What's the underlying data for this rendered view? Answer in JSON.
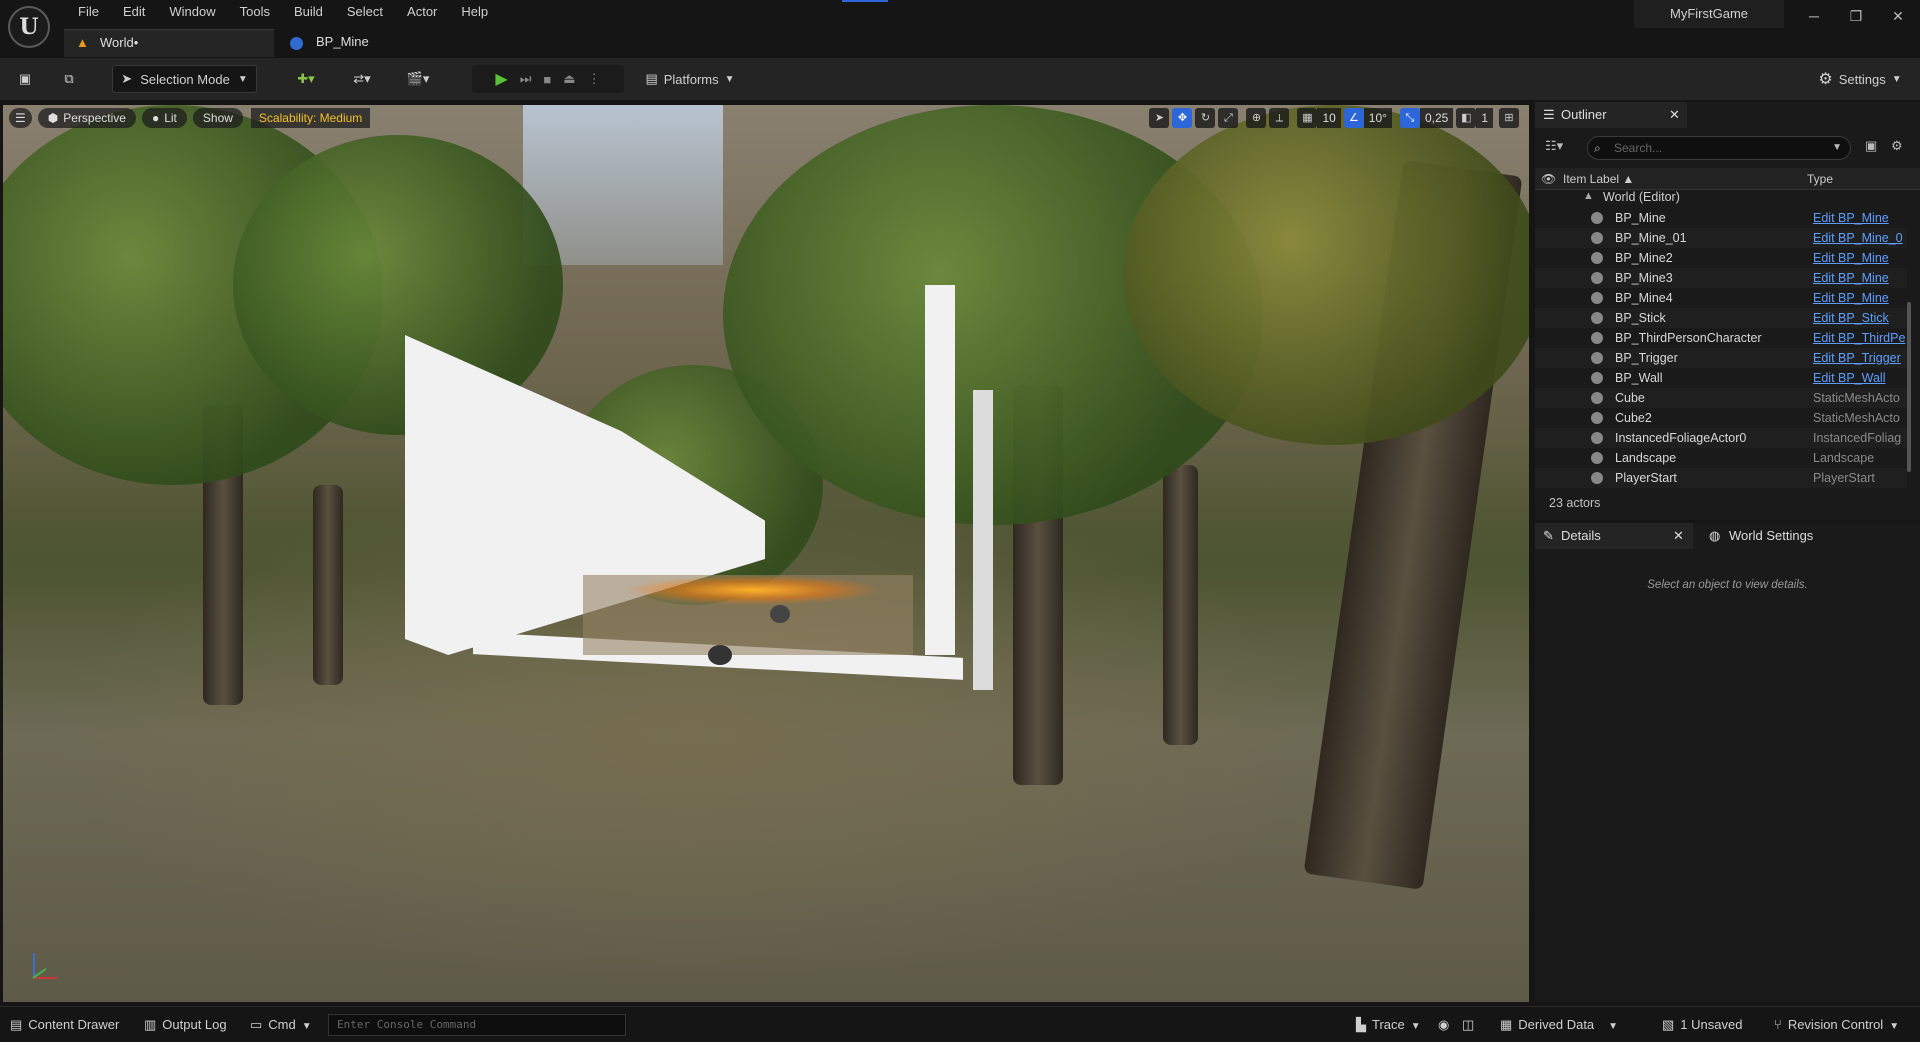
{
  "app": {
    "project": "MyFirstGame",
    "logo": "U"
  },
  "menu": [
    "File",
    "Edit",
    "Window",
    "Tools",
    "Build",
    "Select",
    "Actor",
    "Help"
  ],
  "doc_tabs": {
    "world": "World•",
    "bp": "BP_Mine"
  },
  "toolbar": {
    "selection_mode": "Selection Mode",
    "platforms": "Platforms",
    "settings": "Settings"
  },
  "viewport": {
    "perspective": "Perspective",
    "lit": "Lit",
    "show": "Show",
    "scalability": "Scalability: Medium",
    "grid_snap": "10",
    "rotation_snap": "10°",
    "scale_snap": "0,25",
    "camera_speed": "1"
  },
  "outliner": {
    "tab": "Outliner",
    "search_placeholder": "Search...",
    "col_label": "Item Label ▲",
    "col_type": "Type",
    "root": "World (Editor)",
    "rows": [
      {
        "label": "BP_Mine",
        "type": "Edit BP_Mine",
        "link": true
      },
      {
        "label": "BP_Mine_01",
        "type": "Edit BP_Mine_0",
        "link": true
      },
      {
        "label": "BP_Mine2",
        "type": "Edit BP_Mine",
        "link": true
      },
      {
        "label": "BP_Mine3",
        "type": "Edit BP_Mine",
        "link": true
      },
      {
        "label": "BP_Mine4",
        "type": "Edit BP_Mine",
        "link": true
      },
      {
        "label": "BP_Stick",
        "type": "Edit BP_Stick",
        "link": true
      },
      {
        "label": "BP_ThirdPersonCharacter",
        "type": "Edit BP_ThirdPe",
        "link": true
      },
      {
        "label": "BP_Trigger",
        "type": "Edit BP_Trigger",
        "link": true
      },
      {
        "label": "BP_Wall",
        "type": "Edit BP_Wall",
        "link": true
      },
      {
        "label": "Cube",
        "type": "StaticMeshActo",
        "link": false
      },
      {
        "label": "Cube2",
        "type": "StaticMeshActo",
        "link": false
      },
      {
        "label": "InstancedFoliageActor0",
        "type": "InstancedFoliag",
        "link": false
      },
      {
        "label": "Landscape",
        "type": "Landscape",
        "link": false
      },
      {
        "label": "PlayerStart",
        "type": "PlayerStart",
        "link": false
      }
    ],
    "count": "23 actors"
  },
  "details": {
    "tab": "Details",
    "world_settings": "World Settings",
    "hint": "Select an object to view details."
  },
  "statusbar": {
    "content_drawer": "Content Drawer",
    "output_log": "Output Log",
    "cmd": "Cmd",
    "console_placeholder": "Enter Console Command",
    "trace": "Trace",
    "derived_data": "Derived Data",
    "unsaved": "1 Unsaved",
    "revision_control": "Revision Control"
  }
}
